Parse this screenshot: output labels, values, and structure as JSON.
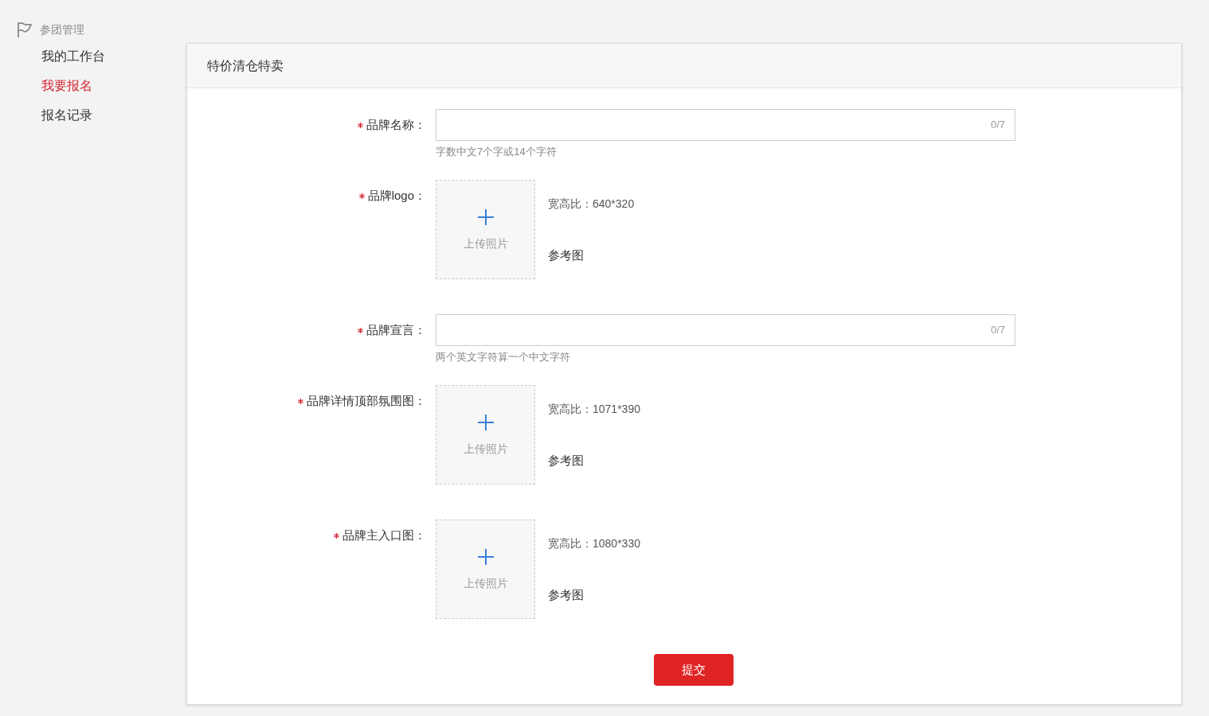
{
  "sidebar": {
    "header": "参团管理",
    "items": [
      {
        "label": "我的工作台",
        "selected": false
      },
      {
        "label": "我要报名",
        "selected": true
      },
      {
        "label": "报名记录",
        "selected": false
      }
    ]
  },
  "panel": {
    "title": "特价清仓特卖"
  },
  "fields": [
    {
      "kind": "text",
      "label": "品牌名称：",
      "required": true,
      "counter": "0/7",
      "hint": "字数中文7个字或14个字符"
    },
    {
      "kind": "upload",
      "label": "品牌logo：",
      "required": true,
      "upload_text": "上传照片",
      "ratio": "宽高比：640*320",
      "reference": "参考图"
    },
    {
      "kind": "text",
      "label": "品牌宣言：",
      "required": true,
      "counter": "0/7",
      "hint": "两个英文字符算一个中文字符"
    },
    {
      "kind": "upload",
      "label": "品牌详情顶部氛围图：",
      "required": true,
      "upload_text": "上传照片",
      "ratio": "宽高比：1071*390",
      "reference": "参考图"
    },
    {
      "kind": "upload",
      "label": "品牌主入口图：",
      "required": true,
      "upload_text": "上传照片",
      "ratio": "宽高比：1080*330",
      "reference": "参考图"
    }
  ],
  "submit": "提交"
}
